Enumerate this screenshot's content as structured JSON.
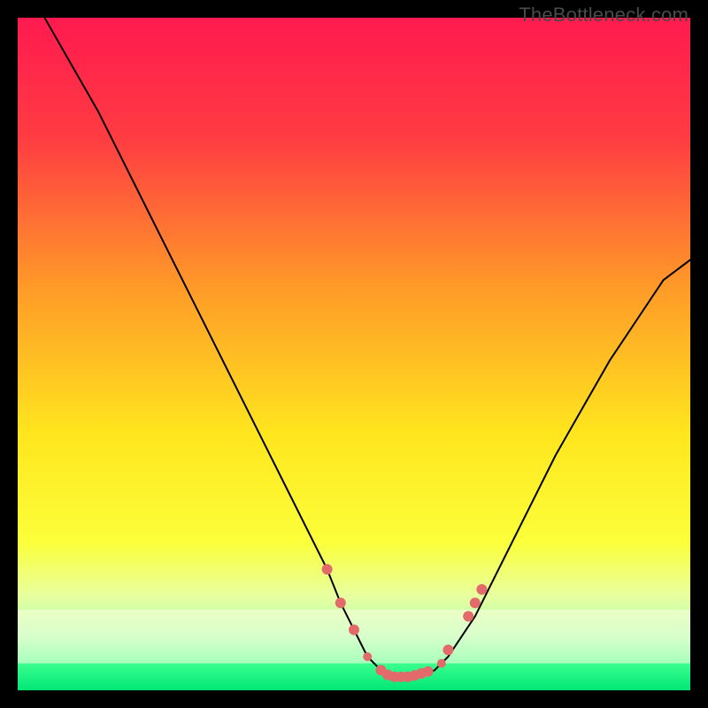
{
  "watermark": "TheBottleneck.com",
  "chart_data": {
    "type": "line",
    "title": "",
    "xlabel": "",
    "ylabel": "",
    "xlim": [
      0,
      100
    ],
    "ylim": [
      0,
      100
    ],
    "grid": false,
    "legend": false,
    "background_gradient_stops": [
      {
        "offset": 0.0,
        "color": "#ff1a4f"
      },
      {
        "offset": 0.18,
        "color": "#ff3c42"
      },
      {
        "offset": 0.4,
        "color": "#ff9a28"
      },
      {
        "offset": 0.62,
        "color": "#ffe61e"
      },
      {
        "offset": 0.78,
        "color": "#fbff3a"
      },
      {
        "offset": 0.86,
        "color": "#e8ffa0"
      },
      {
        "offset": 0.92,
        "color": "#a8ffb0"
      },
      {
        "offset": 0.96,
        "color": "#3cff8e"
      },
      {
        "offset": 1.0,
        "color": "#00e676"
      }
    ],
    "series": [
      {
        "name": "curve",
        "stroke": "#000000",
        "x": [
          0,
          4,
          8,
          12,
          16,
          20,
          24,
          28,
          32,
          36,
          40,
          44,
          46,
          48,
          50,
          52,
          54,
          56,
          58,
          60,
          62,
          64,
          68,
          72,
          76,
          80,
          84,
          88,
          92,
          96,
          100
        ],
        "y": [
          null,
          100,
          93,
          86,
          78,
          70,
          62,
          54,
          46,
          38,
          30,
          22,
          18,
          13,
          9,
          5,
          3,
          2,
          2,
          2,
          3,
          5,
          11,
          19,
          27,
          35,
          42,
          49,
          55,
          61,
          64
        ]
      }
    ],
    "markers": {
      "color": "#e36a6a",
      "radius_small": 6,
      "radius_tiny": 5,
      "points": [
        {
          "x": 46,
          "y": 18,
          "r": 6
        },
        {
          "x": 48,
          "y": 13,
          "r": 6
        },
        {
          "x": 50,
          "y": 9,
          "r": 6
        },
        {
          "x": 52,
          "y": 5,
          "r": 5
        },
        {
          "x": 54,
          "y": 3,
          "r": 6
        },
        {
          "x": 55,
          "y": 2.3,
          "r": 6
        },
        {
          "x": 56,
          "y": 2,
          "r": 6
        },
        {
          "x": 57,
          "y": 2,
          "r": 6
        },
        {
          "x": 58,
          "y": 2,
          "r": 6
        },
        {
          "x": 59,
          "y": 2.2,
          "r": 6
        },
        {
          "x": 60,
          "y": 2.5,
          "r": 6
        },
        {
          "x": 61,
          "y": 2.8,
          "r": 6
        },
        {
          "x": 63,
          "y": 4,
          "r": 5
        },
        {
          "x": 64,
          "y": 6,
          "r": 6
        },
        {
          "x": 67,
          "y": 11,
          "r": 6
        },
        {
          "x": 68,
          "y": 13,
          "r": 6
        },
        {
          "x": 69,
          "y": 15,
          "r": 6
        }
      ]
    }
  }
}
